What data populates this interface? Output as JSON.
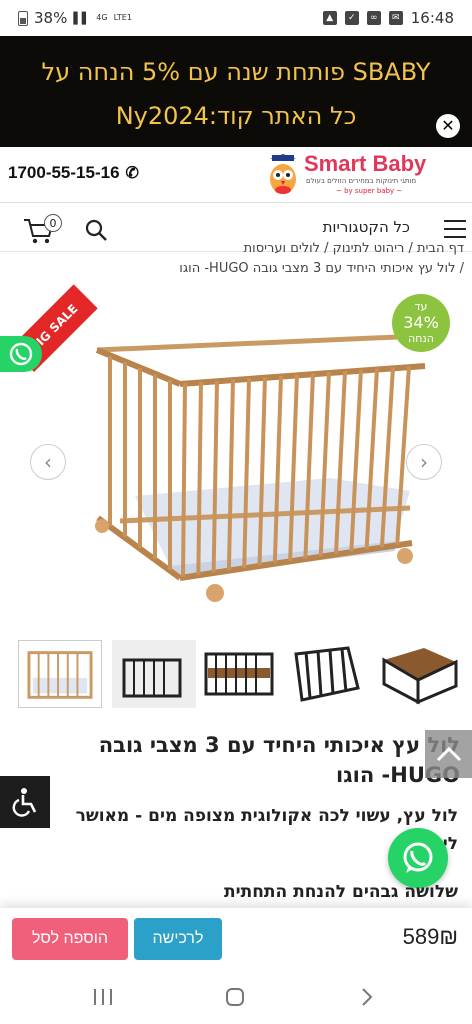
{
  "status_bar": {
    "battery": "38%",
    "network": "4G",
    "network2": "LTE1",
    "time": "16:48"
  },
  "promo": {
    "text": "SBABY פותחת שנה עם 5% הנחה על כל האתר קוד:Ny2024",
    "close_label": "✕"
  },
  "header": {
    "phone": "1700-55-15-16",
    "logo_text": "Smart Baby",
    "logo_sub": "מותגי תינוקות במחירים הזולים בעולם",
    "logo_sub2": "~ by super baby ~"
  },
  "nav": {
    "categories_label": "כל הקטגוריות",
    "cart_count": "0"
  },
  "breadcrumb": {
    "row1": "דף הבית / ריהוט לתינוק / לולים ועריסות",
    "row2": "/  לול עץ איכותי היחיד עם 3 מצבי גובה HUGO- הוגו"
  },
  "gallery": {
    "ribbon": "BIG SALE",
    "discount_top": "עד",
    "discount_pct": "34%",
    "discount_bottom": "הנחה",
    "prev": "‹",
    "next": "›"
  },
  "product": {
    "title": "לול עץ איכותי היחיד עם 3 מצבי גובה HUGO- הוגו",
    "desc": "לול עץ, עשוי לכה אקולוגית מצופה מים - מאושר לילדים",
    "desc2": "שלושה גבהים להנחת התחתית"
  },
  "buy_bar": {
    "price": "589₪",
    "buy_label": "לרכישה",
    "cart_label": "הוספה לסל"
  },
  "colors": {
    "promo_bg": "#0c0b07",
    "promo_text": "#f2c34a",
    "buy_button": "#2ba0c9",
    "cart_button": "#f0607a",
    "discount_badge": "#8dc43f",
    "whatsapp": "#25d366"
  }
}
